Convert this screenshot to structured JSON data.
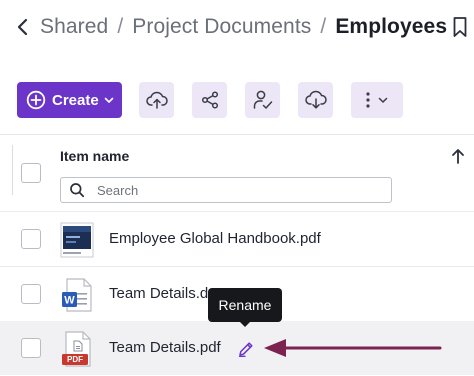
{
  "breadcrumb": {
    "items": [
      "Shared",
      "Project Documents"
    ],
    "separator": "/",
    "current": "Employees"
  },
  "toolbar": {
    "create_label": "Create",
    "buttons": [
      "upload-icon",
      "share-icon",
      "assign-user-icon",
      "download-icon",
      "more-icon"
    ]
  },
  "table": {
    "column_header": "Item name",
    "sort": "ascending",
    "search_placeholder": "Search",
    "rows": [
      {
        "name": "Employee Global Handbook.pdf",
        "type": "pdf-preview"
      },
      {
        "name": "Team Details.d",
        "type": "word-doc"
      },
      {
        "name": "Team Details.pdf",
        "type": "pdf",
        "thumb_badge": "PDF"
      }
    ]
  },
  "tooltip": {
    "text": "Rename"
  },
  "colors": {
    "accent": "#6b35c9",
    "accent_light": "#ece6f7",
    "annotation_arrow": "#7b2250",
    "word_blue": "#2b5bb8",
    "pdf_red": "#c9382e"
  }
}
